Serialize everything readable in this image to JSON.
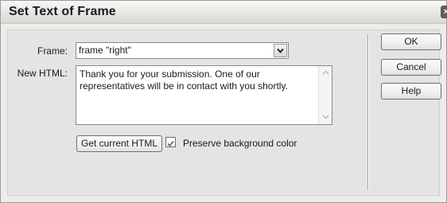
{
  "dialog": {
    "title": "Set Text of Frame"
  },
  "form": {
    "frame_label": "Frame:",
    "frame_value": "frame \"right\"",
    "html_label": "New HTML:",
    "html_value": "Thank you for your submission. One of our representatives will be in contact with you shortly."
  },
  "actions": {
    "get_html_label": "Get current HTML",
    "preserve_bg_label": "Preserve background color",
    "preserve_bg_checked": true
  },
  "buttons": {
    "ok": "OK",
    "cancel": "Cancel",
    "help": "Help"
  }
}
